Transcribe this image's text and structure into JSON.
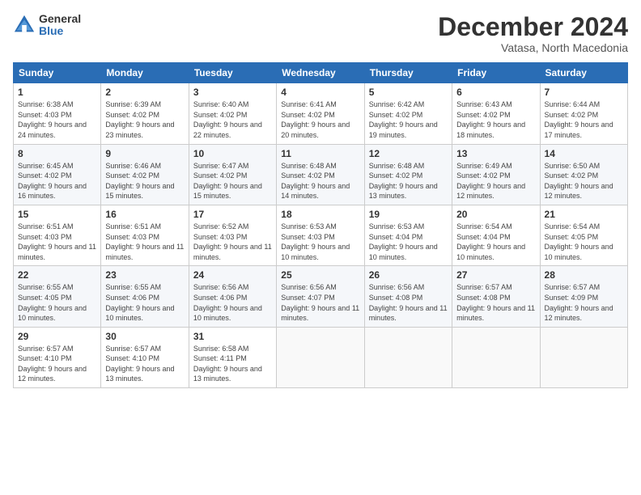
{
  "logo": {
    "general": "General",
    "blue": "Blue"
  },
  "title": "December 2024",
  "location": "Vatasa, North Macedonia",
  "days_header": [
    "Sunday",
    "Monday",
    "Tuesday",
    "Wednesday",
    "Thursday",
    "Friday",
    "Saturday"
  ],
  "weeks": [
    [
      {
        "day": "1",
        "sunrise": "6:38 AM",
        "sunset": "4:03 PM",
        "daylight": "9 hours and 24 minutes."
      },
      {
        "day": "2",
        "sunrise": "6:39 AM",
        "sunset": "4:02 PM",
        "daylight": "9 hours and 23 minutes."
      },
      {
        "day": "3",
        "sunrise": "6:40 AM",
        "sunset": "4:02 PM",
        "daylight": "9 hours and 22 minutes."
      },
      {
        "day": "4",
        "sunrise": "6:41 AM",
        "sunset": "4:02 PM",
        "daylight": "9 hours and 20 minutes."
      },
      {
        "day": "5",
        "sunrise": "6:42 AM",
        "sunset": "4:02 PM",
        "daylight": "9 hours and 19 minutes."
      },
      {
        "day": "6",
        "sunrise": "6:43 AM",
        "sunset": "4:02 PM",
        "daylight": "9 hours and 18 minutes."
      },
      {
        "day": "7",
        "sunrise": "6:44 AM",
        "sunset": "4:02 PM",
        "daylight": "9 hours and 17 minutes."
      }
    ],
    [
      {
        "day": "8",
        "sunrise": "6:45 AM",
        "sunset": "4:02 PM",
        "daylight": "9 hours and 16 minutes."
      },
      {
        "day": "9",
        "sunrise": "6:46 AM",
        "sunset": "4:02 PM",
        "daylight": "9 hours and 15 minutes."
      },
      {
        "day": "10",
        "sunrise": "6:47 AM",
        "sunset": "4:02 PM",
        "daylight": "9 hours and 15 minutes."
      },
      {
        "day": "11",
        "sunrise": "6:48 AM",
        "sunset": "4:02 PM",
        "daylight": "9 hours and 14 minutes."
      },
      {
        "day": "12",
        "sunrise": "6:48 AM",
        "sunset": "4:02 PM",
        "daylight": "9 hours and 13 minutes."
      },
      {
        "day": "13",
        "sunrise": "6:49 AM",
        "sunset": "4:02 PM",
        "daylight": "9 hours and 12 minutes."
      },
      {
        "day": "14",
        "sunrise": "6:50 AM",
        "sunset": "4:02 PM",
        "daylight": "9 hours and 12 minutes."
      }
    ],
    [
      {
        "day": "15",
        "sunrise": "6:51 AM",
        "sunset": "4:03 PM",
        "daylight": "9 hours and 11 minutes."
      },
      {
        "day": "16",
        "sunrise": "6:51 AM",
        "sunset": "4:03 PM",
        "daylight": "9 hours and 11 minutes."
      },
      {
        "day": "17",
        "sunrise": "6:52 AM",
        "sunset": "4:03 PM",
        "daylight": "9 hours and 11 minutes."
      },
      {
        "day": "18",
        "sunrise": "6:53 AM",
        "sunset": "4:03 PM",
        "daylight": "9 hours and 10 minutes."
      },
      {
        "day": "19",
        "sunrise": "6:53 AM",
        "sunset": "4:04 PM",
        "daylight": "9 hours and 10 minutes."
      },
      {
        "day": "20",
        "sunrise": "6:54 AM",
        "sunset": "4:04 PM",
        "daylight": "9 hours and 10 minutes."
      },
      {
        "day": "21",
        "sunrise": "6:54 AM",
        "sunset": "4:05 PM",
        "daylight": "9 hours and 10 minutes."
      }
    ],
    [
      {
        "day": "22",
        "sunrise": "6:55 AM",
        "sunset": "4:05 PM",
        "daylight": "9 hours and 10 minutes."
      },
      {
        "day": "23",
        "sunrise": "6:55 AM",
        "sunset": "4:06 PM",
        "daylight": "9 hours and 10 minutes."
      },
      {
        "day": "24",
        "sunrise": "6:56 AM",
        "sunset": "4:06 PM",
        "daylight": "9 hours and 10 minutes."
      },
      {
        "day": "25",
        "sunrise": "6:56 AM",
        "sunset": "4:07 PM",
        "daylight": "9 hours and 11 minutes."
      },
      {
        "day": "26",
        "sunrise": "6:56 AM",
        "sunset": "4:08 PM",
        "daylight": "9 hours and 11 minutes."
      },
      {
        "day": "27",
        "sunrise": "6:57 AM",
        "sunset": "4:08 PM",
        "daylight": "9 hours and 11 minutes."
      },
      {
        "day": "28",
        "sunrise": "6:57 AM",
        "sunset": "4:09 PM",
        "daylight": "9 hours and 12 minutes."
      }
    ],
    [
      {
        "day": "29",
        "sunrise": "6:57 AM",
        "sunset": "4:10 PM",
        "daylight": "9 hours and 12 minutes."
      },
      {
        "day": "30",
        "sunrise": "6:57 AM",
        "sunset": "4:10 PM",
        "daylight": "9 hours and 13 minutes."
      },
      {
        "day": "31",
        "sunrise": "6:58 AM",
        "sunset": "4:11 PM",
        "daylight": "9 hours and 13 minutes."
      },
      null,
      null,
      null,
      null
    ]
  ]
}
